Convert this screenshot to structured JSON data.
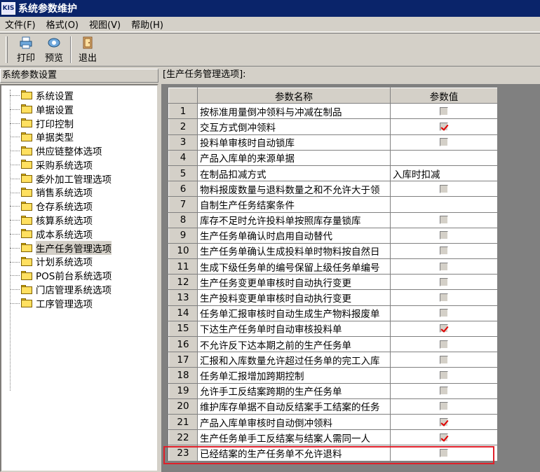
{
  "window": {
    "title": "系统参数维护",
    "icon_text": "KIS"
  },
  "menu": [
    "文件(F)",
    "格式(O)",
    "视图(V)",
    "帮助(H)"
  ],
  "toolbar": {
    "print": "打印",
    "preview": "预览",
    "exit": "退出"
  },
  "left_panel": {
    "header": "系统参数设置",
    "items": [
      "系统设置",
      "单据设置",
      "打印控制",
      "单据类型",
      "供应链整体选项",
      "采购系统选项",
      "委外加工管理选项",
      "销售系统选项",
      "仓存系统选项",
      "核算系统选项",
      "成本系统选项",
      "生产任务管理选项",
      "计划系统选项",
      "POS前台系统选项",
      "门店管理系统选项",
      "工序管理选项"
    ],
    "selected_index": 11
  },
  "right_panel": {
    "header": "[生产任务管理选项]:",
    "columns": [
      "参数名称",
      "参数值"
    ],
    "rows": [
      {
        "num": "1",
        "name": "按标准用量倒冲领料与冲减在制品",
        "type": "checkbox",
        "checked": false
      },
      {
        "num": "2",
        "name": "交互方式倒冲领料",
        "type": "checkbox",
        "checked": true
      },
      {
        "num": "3",
        "name": "投料单审核时自动锁库",
        "type": "checkbox",
        "checked": false
      },
      {
        "num": "4",
        "name": "产品入库单的来源单据",
        "type": "empty"
      },
      {
        "num": "5",
        "name": "在制品扣减方式",
        "type": "text",
        "value": "入库时扣减"
      },
      {
        "num": "6",
        "name": "物料报废数量与退料数量之和不允许大于领",
        "type": "checkbox",
        "checked": false
      },
      {
        "num": "7",
        "name": "自制生产任务结案条件",
        "type": "empty"
      },
      {
        "num": "8",
        "name": "库存不足时允许投料单按照库存量锁库",
        "type": "checkbox",
        "checked": false
      },
      {
        "num": "9",
        "name": "生产任务单确认时启用自动替代",
        "type": "checkbox",
        "checked": false
      },
      {
        "num": "10",
        "name": "生产任务单确认生成投料单时物料按自然日",
        "type": "checkbox",
        "checked": false
      },
      {
        "num": "11",
        "name": "生成下级任务单的编号保留上级任务单编号",
        "type": "checkbox",
        "checked": false
      },
      {
        "num": "12",
        "name": "生产任务变更单审核时自动执行变更",
        "type": "checkbox",
        "checked": false
      },
      {
        "num": "13",
        "name": "生产投料变更单审核时自动执行变更",
        "type": "checkbox",
        "checked": false
      },
      {
        "num": "14",
        "name": "任务单汇报审核时自动生成生产物料报废单",
        "type": "checkbox",
        "checked": false
      },
      {
        "num": "15",
        "name": "下达生产任务单时自动审核投料单",
        "type": "checkbox",
        "checked": true
      },
      {
        "num": "16",
        "name": "不允许反下达本期之前的生产任务单",
        "type": "checkbox",
        "checked": false
      },
      {
        "num": "17",
        "name": "汇报和入库数量允许超过任务单的完工入库",
        "type": "checkbox",
        "checked": false
      },
      {
        "num": "18",
        "name": "任务单汇报增加跨期控制",
        "type": "checkbox",
        "checked": false
      },
      {
        "num": "19",
        "name": "允许手工反结案跨期的生产任务单",
        "type": "checkbox",
        "checked": false
      },
      {
        "num": "20",
        "name": "维护库存单据不自动反结案手工结案的任务",
        "type": "checkbox",
        "checked": false
      },
      {
        "num": "21",
        "name": "产品入库单审核时自动倒冲领料",
        "type": "checkbox",
        "checked": true
      },
      {
        "num": "22",
        "name": "生产任务单手工反结案与结案人需同一人",
        "type": "checkbox",
        "checked": true
      },
      {
        "num": "23",
        "name": "已经结案的生产任务单不允许退料",
        "type": "checkbox",
        "checked": false
      }
    ]
  },
  "colors": {
    "titlebar": "#0a246a",
    "face": "#d4d0c8",
    "highlight": "#e0202a",
    "check": "#e00000"
  }
}
